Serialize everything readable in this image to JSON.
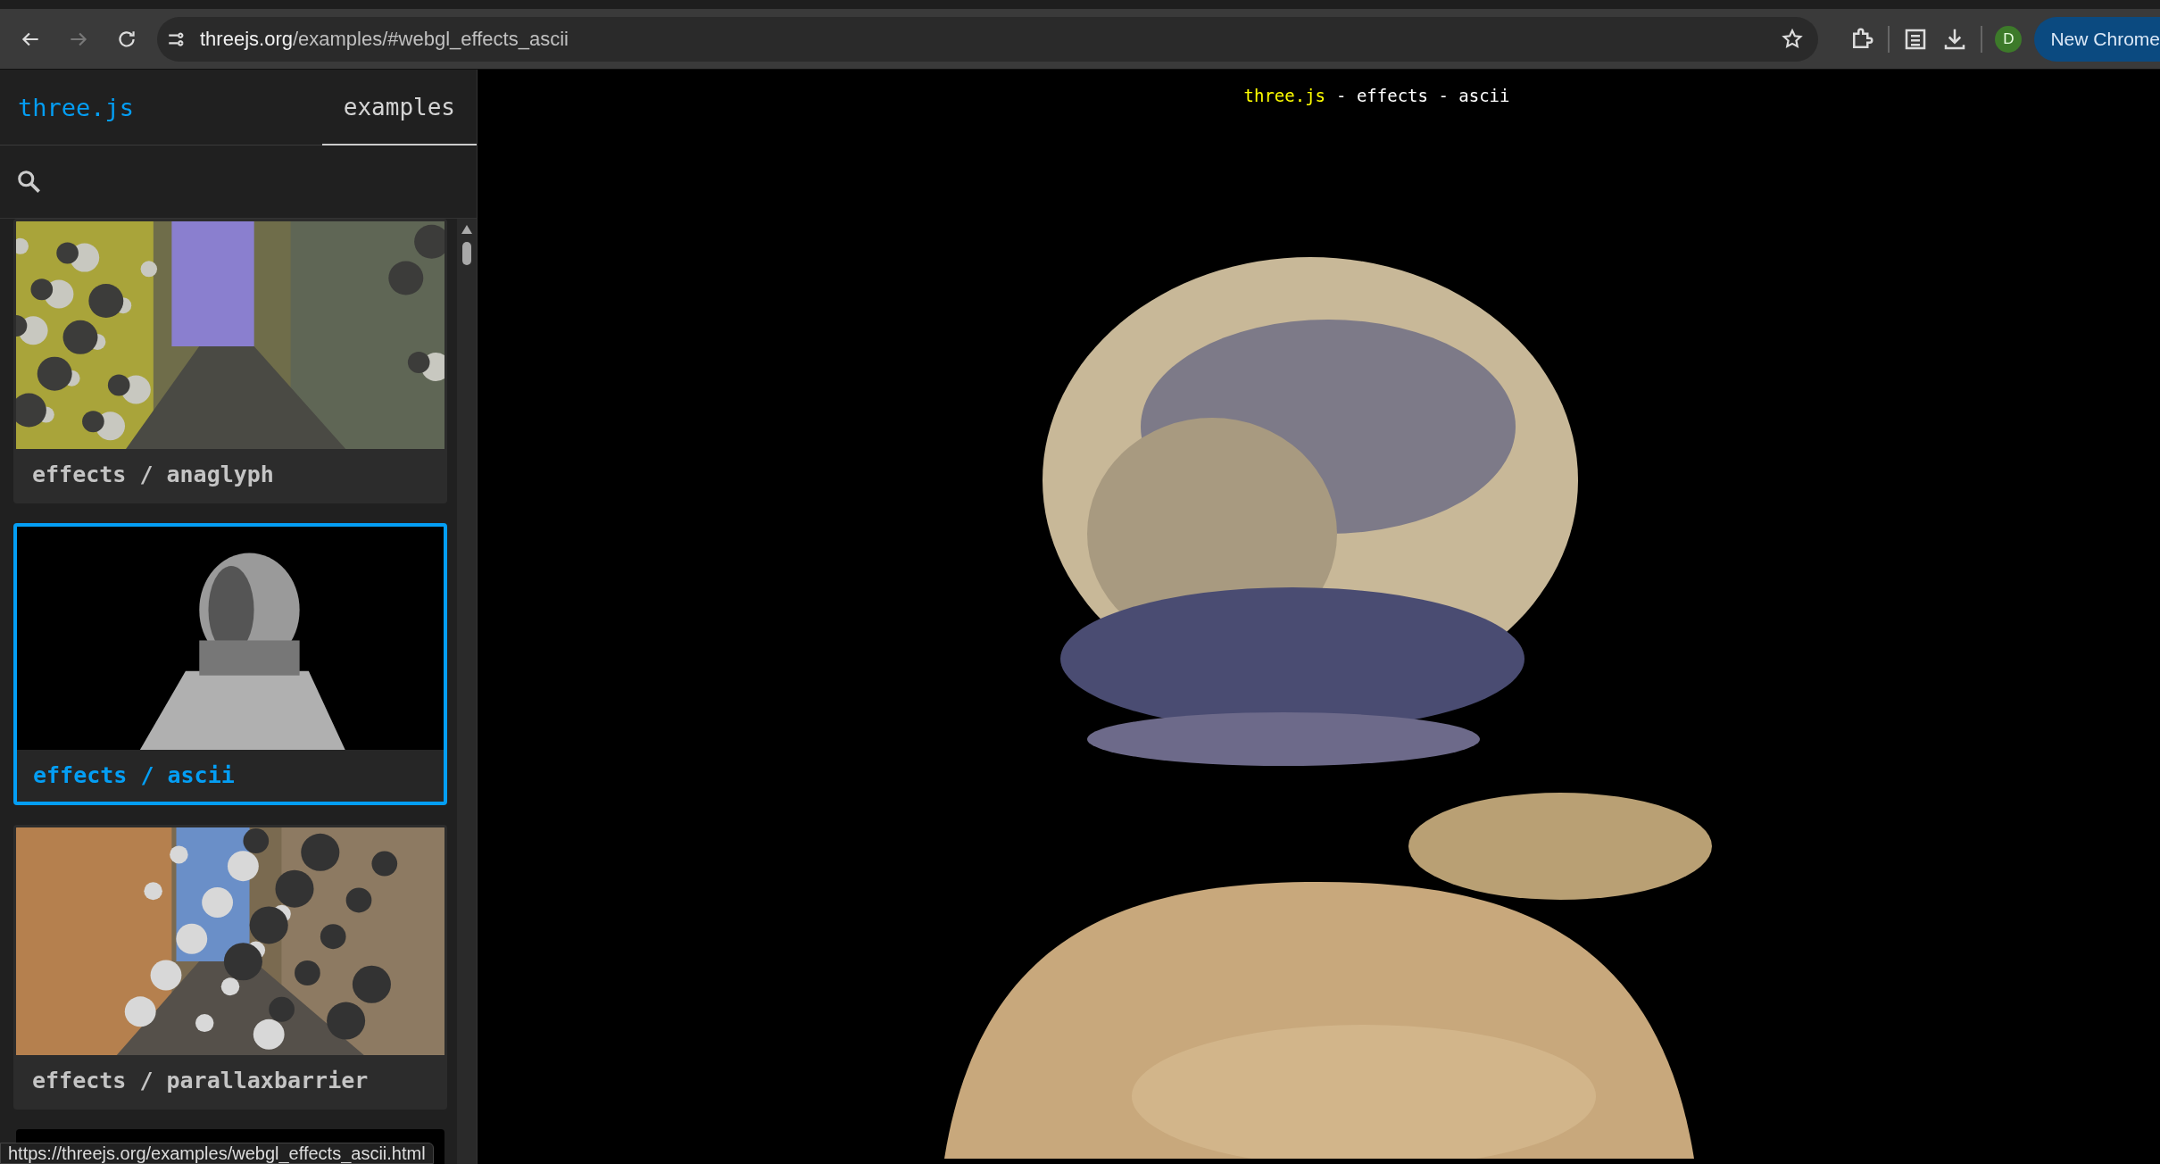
{
  "browser": {
    "url_host": "threejs.org",
    "url_path": "/examples/#webgl_effects_ascii",
    "forward_disabled": true,
    "bookmarked": false,
    "profile_initial": "D",
    "promo_button": "New Chrome"
  },
  "sidebar": {
    "logo": "three.js",
    "tabs": [
      {
        "label": "examples",
        "selected": true
      }
    ],
    "cards": [
      {
        "label": "effects / anaglyph",
        "selected": false
      },
      {
        "label": "effects / ascii",
        "selected": true
      },
      {
        "label": "effects / parallaxbarrier",
        "selected": false
      }
    ]
  },
  "main": {
    "title_link": "three.js",
    "title_text": "- effects - ascii"
  },
  "status_bar": {
    "url": "https://threejs.org/examples/webgl_effects_ascii.html"
  }
}
